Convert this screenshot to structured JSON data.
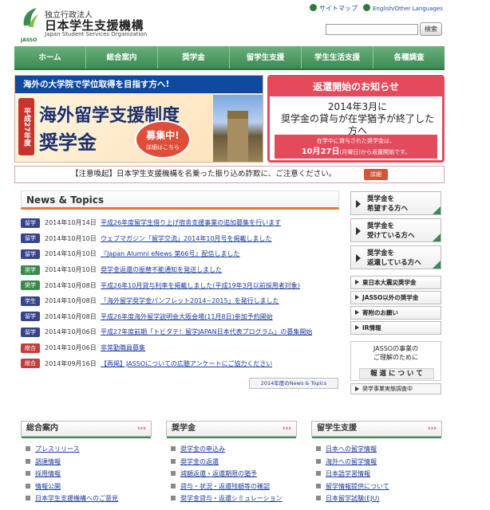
{
  "header": {
    "org_sub": "独立行政法人",
    "org_name": "日本学生支援機構",
    "org_en": "Japan Student Services Organization",
    "logo_text": "JASSO",
    "sitemap": "サイトマップ",
    "language": "English/Other Languages",
    "search_placeholder": "",
    "search_button": "検索"
  },
  "nav": [
    "ホーム",
    "総合案内",
    "奨学金",
    "留学生支援",
    "学生生活支援",
    "各種調査"
  ],
  "banner_left": {
    "top": "海外の大学院で学位取得を目指す方へ!",
    "era": "平成27年度",
    "title1": "海外留学支援制度",
    "title2": "奨学金",
    "badge": "募集中!",
    "badge_sub": "詳細はこちら"
  },
  "banner_right": {
    "head": "返還開始のお知らせ",
    "text1": "2014年3月に",
    "text2": "奨学金の貸与が在学猶予が終了した方へ",
    "foot1": "在学中に貸与された奨学金は、",
    "foot2": "10月27日",
    "foot3": "(月曜日)から返還開始です。"
  },
  "warning": {
    "text": "【注意喚起】日本学生支援機構を名乗った振り込め詐欺に、ご注意ください。",
    "button": "詳細"
  },
  "news": {
    "title": "News & Topics",
    "items": [
      {
        "tag": "留学",
        "color": "blue",
        "date": "2014年10月14日",
        "text": "平成26年度留学生借り上げ宿舎支援事業の追加募集を行います"
      },
      {
        "tag": "留学",
        "color": "blue",
        "date": "2014年10月10日",
        "text": "ウェブマガジン「留学交流」2014年10月号を掲載しました"
      },
      {
        "tag": "留学",
        "color": "blue",
        "date": "2014年10月10日",
        "text": "『Japan Alumni eNews 第66号』配信しました"
      },
      {
        "tag": "奨学",
        "color": "green",
        "date": "2014年10月10日",
        "text": "奨学金返還の振替不能通知を発送しました"
      },
      {
        "tag": "奨学",
        "color": "green",
        "date": "2014年10月08日",
        "text": "平成26年10月貸与利率を掲載しました(平成19年3月以前採用者対象)"
      },
      {
        "tag": "学生",
        "color": "blue",
        "date": "2014年10月08日",
        "text": "「海外留学奨学金パンフレット2014~2015」を発行しました"
      },
      {
        "tag": "留学",
        "color": "blue",
        "date": "2014年10月08日",
        "text": "平成26年度海外留学説明会大阪会場(11月8日)参加予約開始"
      },
      {
        "tag": "留学",
        "color": "blue",
        "date": "2014年10月06日",
        "text": "平成27年度前期「トビタテ！留学JAPAN日本代表プログラム」の募集開始"
      },
      {
        "tag": "総合",
        "color": "red",
        "date": "2014年10月06日",
        "text": "非常勤職員募集"
      },
      {
        "tag": "総合",
        "color": "red",
        "date": "2014年09月16日",
        "text": "【再掲】JASSOについての広聴アンケートにご協力ください"
      }
    ],
    "more": "2014年度のNews & Topics"
  },
  "right": {
    "buttons": [
      {
        "l1": "奨学金を",
        "l2": "希望する方へ"
      },
      {
        "l1": "奨学金を",
        "l2": "受けている方へ"
      },
      {
        "l1": "奨学金を",
        "l2": "返還している方へ"
      }
    ],
    "links": [
      "東日本大震災奨学金",
      "JASSO以外の奨学金",
      "寄附のお願い",
      "IR情報"
    ],
    "jasso_box1": "JASSOの事業の",
    "jasso_box2": "ご理解のために",
    "jasso_box_btn": "報 道 に つ い て",
    "survey": "奨学事業実態調査中"
  },
  "sections": [
    {
      "title": "総合案内",
      "items": [
        "プレスリリース",
        "調達情報",
        "採用情報",
        "情報公開",
        "日本学生支援機構へのご意見"
      ]
    },
    {
      "title": "奨学金",
      "items": [
        "奨学金の申込み",
        "奨学金の返還",
        "減額返還・返還期限の猶予",
        "貸与・状況・返還残額等の確認",
        "奨学金貸与・返還シミュレーション"
      ]
    },
    {
      "title": "留学生支援",
      "items": [
        "日本への留学情報",
        "海外への留学情報",
        "日本語学習情報",
        "留学情報提供について",
        "日本留学試験(EJU)"
      ]
    }
  ],
  "colors": {
    "nav": "#3c8a52",
    "accent": "#e34a5c",
    "link": "#1a3aa0"
  }
}
